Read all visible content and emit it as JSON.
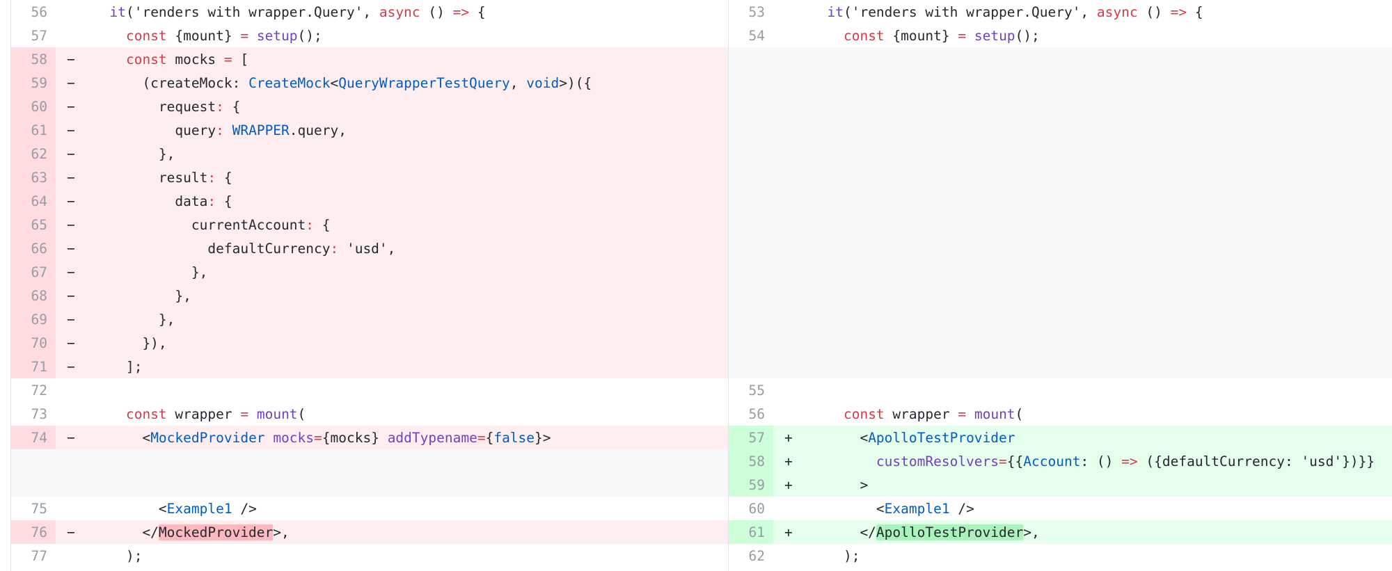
{
  "colors": {
    "deleted_row": "#ffeef0",
    "deleted_gutter": "#ffdce0",
    "added_row": "#e6ffed",
    "added_gutter": "#cdffd8",
    "filler": "#f6f8fa",
    "keyword": "#d73a49",
    "function": "#6f42c1",
    "type": "#005cc5"
  },
  "left": [
    {
      "n": "56",
      "m": "",
      "kind": "ctx",
      "t": [
        [
          "  "
        ],
        [
          "it",
          "fn"
        ],
        [
          "('renders with wrapper.Query', "
        ],
        [
          "async",
          "kw"
        ],
        [
          " () "
        ],
        [
          "=>",
          "kw"
        ],
        [
          " {"
        ]
      ]
    },
    {
      "n": "57",
      "m": "",
      "kind": "ctx",
      "t": [
        [
          "    "
        ],
        [
          "const",
          "kw"
        ],
        [
          " {mount} "
        ],
        [
          "=",
          "kw"
        ],
        [
          " "
        ],
        [
          "setup",
          "fn"
        ],
        [
          "();"
        ]
      ]
    },
    {
      "n": "58",
      "m": "−",
      "kind": "del",
      "t": [
        [
          "    "
        ],
        [
          "const",
          "kw"
        ],
        [
          " mocks "
        ],
        [
          "=",
          "kw"
        ],
        [
          " ["
        ]
      ]
    },
    {
      "n": "59",
      "m": "−",
      "kind": "del",
      "t": [
        [
          "      (createMock: "
        ],
        [
          "CreateMock",
          "typ"
        ],
        [
          "<"
        ],
        [
          "QueryWrapperTestQuery",
          "typ"
        ],
        [
          ", "
        ],
        [
          "void",
          "typ"
        ],
        [
          ">)({"
        ]
      ]
    },
    {
      "n": "60",
      "m": "−",
      "kind": "del",
      "t": [
        [
          "        request"
        ],
        [
          ":",
          "kw"
        ],
        [
          " {"
        ]
      ]
    },
    {
      "n": "61",
      "m": "−",
      "kind": "del",
      "t": [
        [
          "          query"
        ],
        [
          ":",
          "kw"
        ],
        [
          " "
        ],
        [
          "WRAPPER",
          "typ"
        ],
        [
          "."
        ],
        [
          "query,"
        ]
      ]
    },
    {
      "n": "62",
      "m": "−",
      "kind": "del",
      "t": [
        [
          "        },"
        ]
      ]
    },
    {
      "n": "63",
      "m": "−",
      "kind": "del",
      "t": [
        [
          "        result"
        ],
        [
          ":",
          "kw"
        ],
        [
          " {"
        ]
      ]
    },
    {
      "n": "64",
      "m": "−",
      "kind": "del",
      "t": [
        [
          "          data"
        ],
        [
          ":",
          "kw"
        ],
        [
          " {"
        ]
      ]
    },
    {
      "n": "65",
      "m": "−",
      "kind": "del",
      "t": [
        [
          "            currentAccount"
        ],
        [
          ":",
          "kw"
        ],
        [
          " {"
        ]
      ]
    },
    {
      "n": "66",
      "m": "−",
      "kind": "del",
      "t": [
        [
          "              defaultCurrency"
        ],
        [
          ":",
          "kw"
        ],
        [
          " 'usd',"
        ]
      ]
    },
    {
      "n": "67",
      "m": "−",
      "kind": "del",
      "t": [
        [
          "            },"
        ]
      ]
    },
    {
      "n": "68",
      "m": "−",
      "kind": "del",
      "t": [
        [
          "          },"
        ]
      ]
    },
    {
      "n": "69",
      "m": "−",
      "kind": "del",
      "t": [
        [
          "        },"
        ]
      ]
    },
    {
      "n": "70",
      "m": "−",
      "kind": "del",
      "t": [
        [
          "      }),"
        ]
      ]
    },
    {
      "n": "71",
      "m": "−",
      "kind": "del",
      "t": [
        [
          "    ];"
        ]
      ]
    },
    {
      "n": "72",
      "m": "",
      "kind": "ctx",
      "t": [
        [
          ""
        ]
      ]
    },
    {
      "n": "73",
      "m": "",
      "kind": "ctx",
      "t": [
        [
          "    "
        ],
        [
          "const",
          "kw"
        ],
        [
          " wrapper "
        ],
        [
          "=",
          "kw"
        ],
        [
          " "
        ],
        [
          "mount",
          "fn"
        ],
        [
          "("
        ]
      ]
    },
    {
      "n": "74",
      "m": "−",
      "kind": "del",
      "t": [
        [
          "      <"
        ],
        [
          "MockedProvider",
          "typ"
        ],
        [
          " "
        ],
        [
          "mocks",
          "fn"
        ],
        [
          "=",
          "kw"
        ],
        [
          "{mocks} "
        ],
        [
          "addTypename",
          "fn"
        ],
        [
          "=",
          "kw"
        ],
        [
          "{"
        ],
        [
          "false",
          "typ"
        ],
        [
          "}>"
        ]
      ]
    },
    {
      "n": "",
      "m": "",
      "kind": "filler",
      "t": []
    },
    {
      "n": "",
      "m": "",
      "kind": "filler",
      "t": []
    },
    {
      "n": "75",
      "m": "",
      "kind": "ctx",
      "t": [
        [
          "        <"
        ],
        [
          "Example1",
          "typ"
        ],
        [
          " />"
        ]
      ]
    },
    {
      "n": "76",
      "m": "−",
      "kind": "del",
      "t": [
        [
          "      </"
        ],
        [
          "MockedProvider",
          "hl-del"
        ],
        [
          ">,"
        ]
      ]
    },
    {
      "n": "77",
      "m": "",
      "kind": "ctx",
      "t": [
        [
          "    );"
        ]
      ]
    }
  ],
  "right": [
    {
      "n": "53",
      "m": "",
      "kind": "ctx",
      "t": [
        [
          "  "
        ],
        [
          "it",
          "fn"
        ],
        [
          "('renders with wrapper.Query', "
        ],
        [
          "async",
          "kw"
        ],
        [
          " () "
        ],
        [
          "=>",
          "kw"
        ],
        [
          " {"
        ]
      ]
    },
    {
      "n": "54",
      "m": "",
      "kind": "ctx",
      "t": [
        [
          "    "
        ],
        [
          "const",
          "kw"
        ],
        [
          " {mount} "
        ],
        [
          "=",
          "kw"
        ],
        [
          " "
        ],
        [
          "setup",
          "fn"
        ],
        [
          "();"
        ]
      ]
    },
    {
      "n": "",
      "m": "",
      "kind": "filler",
      "t": []
    },
    {
      "n": "",
      "m": "",
      "kind": "filler",
      "t": []
    },
    {
      "n": "",
      "m": "",
      "kind": "filler",
      "t": []
    },
    {
      "n": "",
      "m": "",
      "kind": "filler",
      "t": []
    },
    {
      "n": "",
      "m": "",
      "kind": "filler",
      "t": []
    },
    {
      "n": "",
      "m": "",
      "kind": "filler",
      "t": []
    },
    {
      "n": "",
      "m": "",
      "kind": "filler",
      "t": []
    },
    {
      "n": "",
      "m": "",
      "kind": "filler",
      "t": []
    },
    {
      "n": "",
      "m": "",
      "kind": "filler",
      "t": []
    },
    {
      "n": "",
      "m": "",
      "kind": "filler",
      "t": []
    },
    {
      "n": "",
      "m": "",
      "kind": "filler",
      "t": []
    },
    {
      "n": "",
      "m": "",
      "kind": "filler",
      "t": []
    },
    {
      "n": "",
      "m": "",
      "kind": "filler",
      "t": []
    },
    {
      "n": "",
      "m": "",
      "kind": "filler",
      "t": []
    },
    {
      "n": "55",
      "m": "",
      "kind": "ctx",
      "t": [
        [
          ""
        ]
      ]
    },
    {
      "n": "56",
      "m": "",
      "kind": "ctx",
      "t": [
        [
          "    "
        ],
        [
          "const",
          "kw"
        ],
        [
          " wrapper "
        ],
        [
          "=",
          "kw"
        ],
        [
          " "
        ],
        [
          "mount",
          "fn"
        ],
        [
          "("
        ]
      ]
    },
    {
      "n": "57",
      "m": "+",
      "kind": "add",
      "t": [
        [
          "      <"
        ],
        [
          "ApolloTestProvider",
          "typ"
        ]
      ]
    },
    {
      "n": "58",
      "m": "+",
      "kind": "add",
      "t": [
        [
          "        "
        ],
        [
          "customResolvers",
          "fn"
        ],
        [
          "=",
          "kw"
        ],
        [
          "{{"
        ],
        [
          "Account",
          "typ"
        ],
        [
          ": () "
        ],
        [
          "=>",
          "kw"
        ],
        [
          " ({defaultCurrency: 'usd'})}}"
        ]
      ]
    },
    {
      "n": "59",
      "m": "+",
      "kind": "add",
      "t": [
        [
          "      >"
        ]
      ]
    },
    {
      "n": "60",
      "m": "",
      "kind": "ctx",
      "t": [
        [
          "        <"
        ],
        [
          "Example1",
          "typ"
        ],
        [
          " />"
        ]
      ]
    },
    {
      "n": "61",
      "m": "+",
      "kind": "add",
      "t": [
        [
          "      </"
        ],
        [
          "ApolloTestProvider",
          "hl-add"
        ],
        [
          ">,"
        ]
      ]
    },
    {
      "n": "62",
      "m": "",
      "kind": "ctx",
      "t": [
        [
          "    );"
        ]
      ]
    }
  ]
}
